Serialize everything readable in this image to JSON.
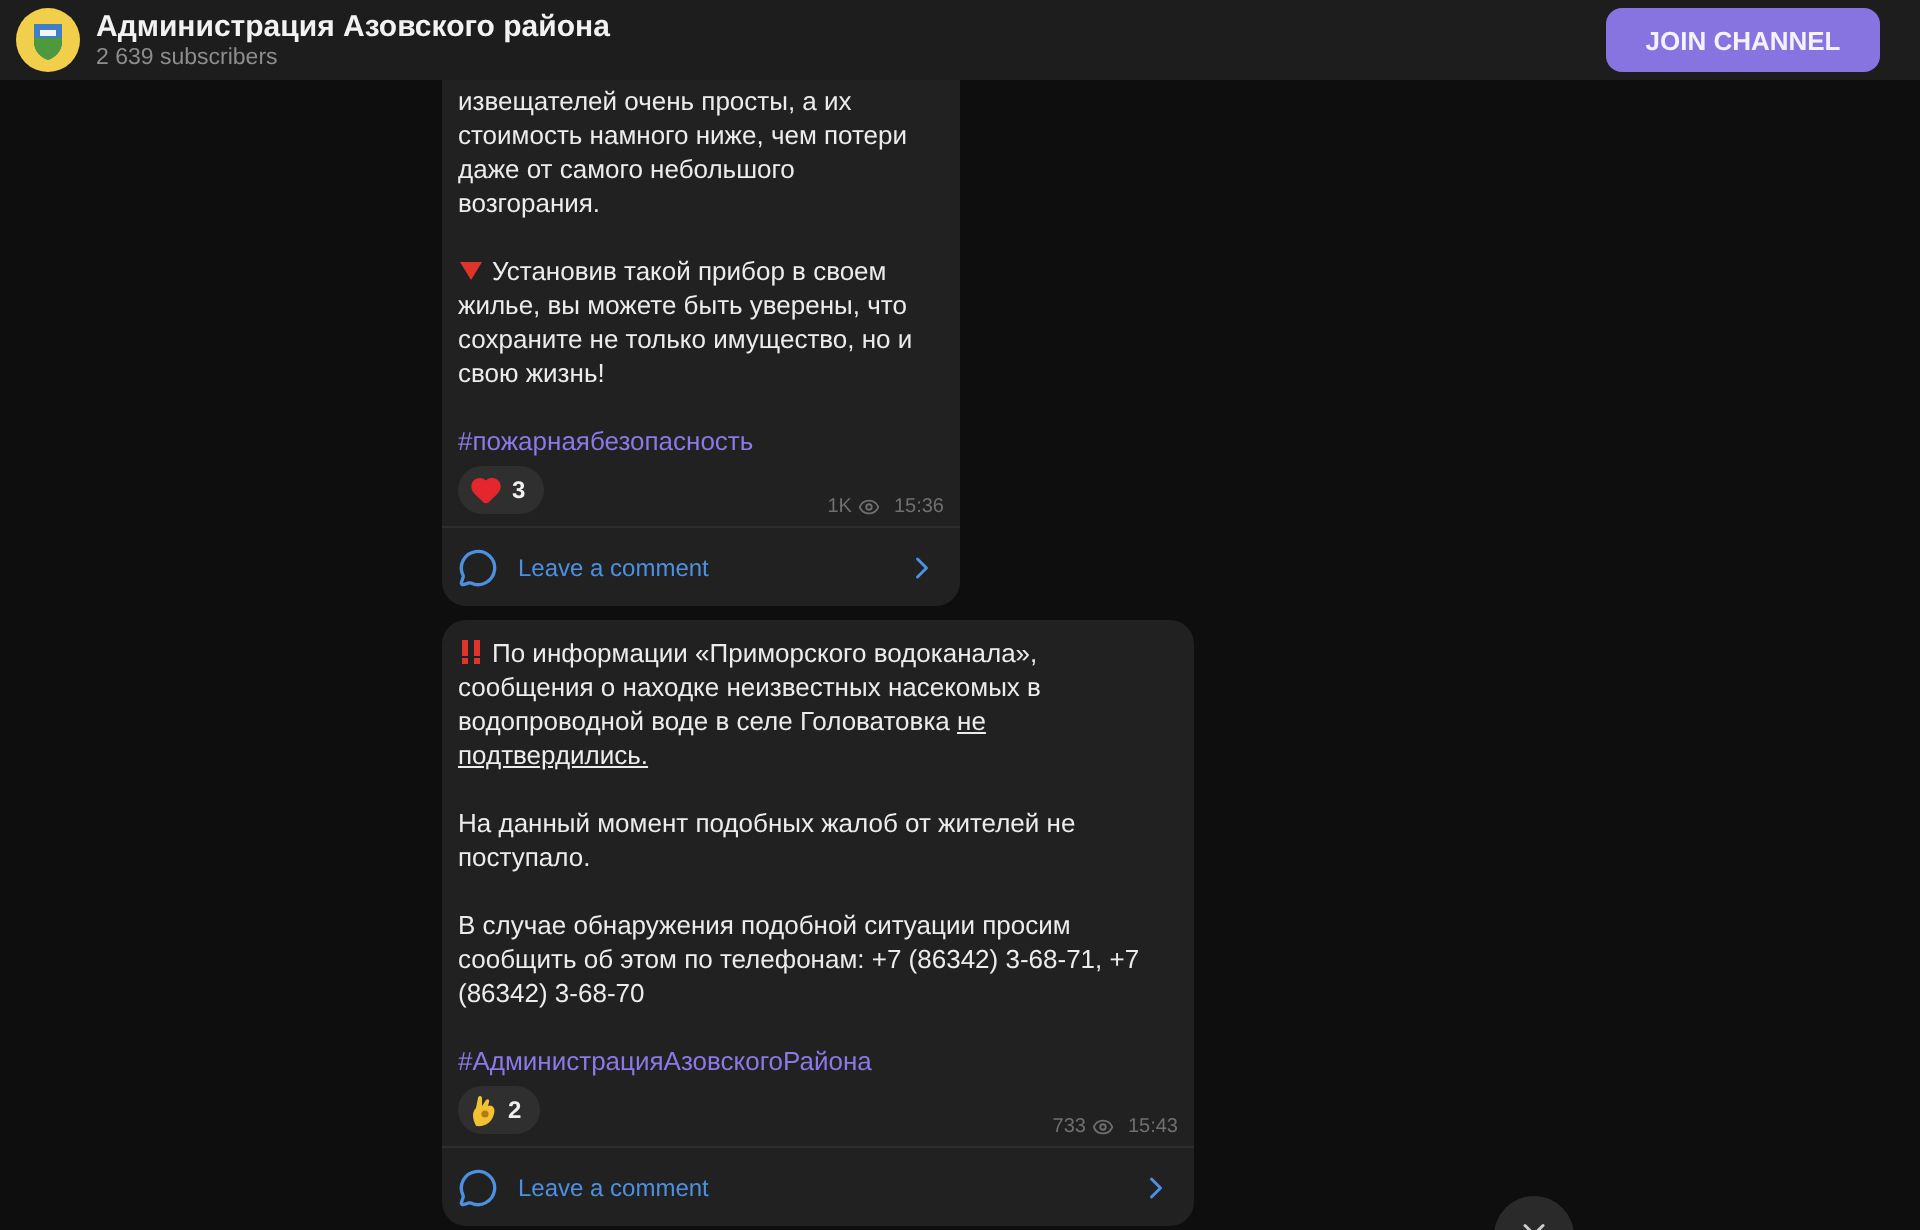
{
  "channel": {
    "name": "Администрация Азовского района",
    "subscribers": "2 639 subscribers"
  },
  "join_button": "JOIN CHANNEL",
  "posts": [
    {
      "cut_top": true,
      "paragraphs": [
        {
          "kind": "plain",
          "segments": [
            {
              "text": "извещателей очень просты, а их стоимость намного ниже, чем потери даже от самого небольшого возгорания.",
              "underline": false
            }
          ]
        },
        {
          "kind": "triangle",
          "segments": [
            {
              "text": "Установив такой прибор в своем жилье, вы можете быть уверены, что сохраните не только имущество, но и свою жизнь!",
              "underline": false
            }
          ]
        }
      ],
      "hashtag": "#пожарнаябезопасность",
      "reaction": {
        "kind": "heart",
        "count": "3"
      },
      "views": "1K",
      "time": "15:36",
      "comment": "Leave a comment"
    },
    {
      "cut_top": false,
      "paragraphs": [
        {
          "kind": "alert",
          "segments": [
            {
              "text": "По информации «Приморского водоканала», сообщения о находке неизвестных насекомых в водопроводной воде в селе Головатовка ",
              "underline": false
            },
            {
              "text": "не подтвердились.",
              "underline": true
            }
          ]
        },
        {
          "kind": "plain",
          "segments": [
            {
              "text": "На данный момент подобных жалоб от жителей не поступало.",
              "underline": false
            }
          ]
        },
        {
          "kind": "plain",
          "segments": [
            {
              "text": "В случае обнаружения подобной ситуации просим сообщить об этом по телефонам: +7 (86342) 3-68-71, +7 (86342) 3-68-70",
              "underline": false
            }
          ]
        }
      ],
      "hashtag": "#АдминистрацияАзовскогоРайона",
      "reaction": {
        "kind": "hand",
        "count": "2"
      },
      "views": "733",
      "time": "15:43",
      "comment": "Leave a comment"
    }
  ]
}
